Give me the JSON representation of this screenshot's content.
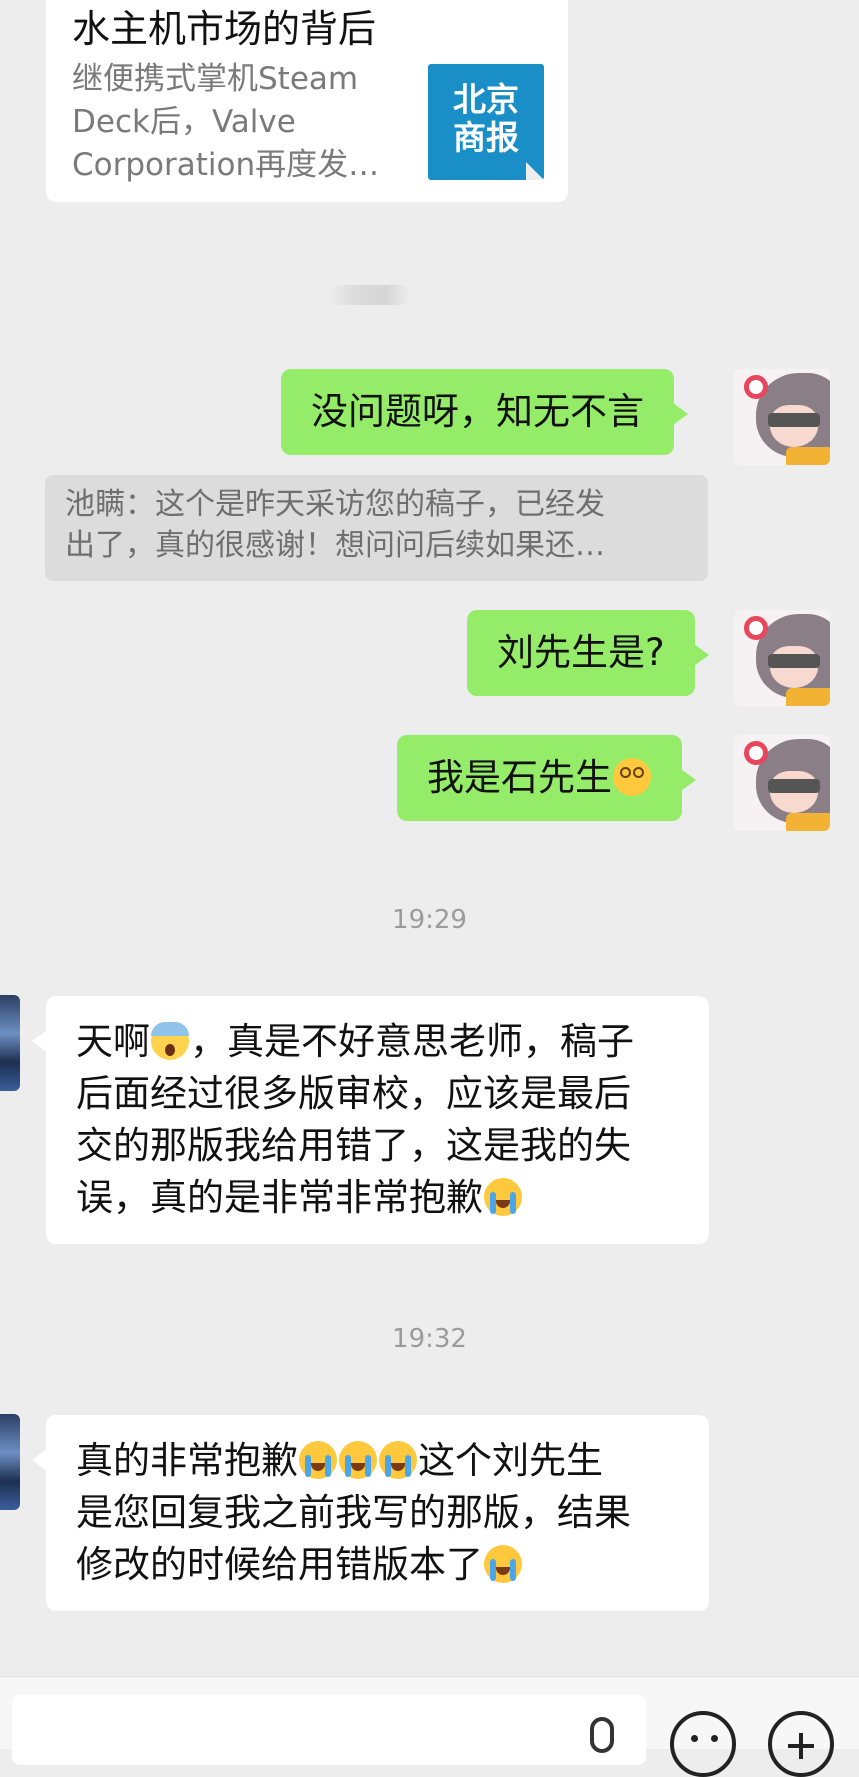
{
  "article_card": {
    "title": "水主机市场的背后",
    "description_lines": [
      "继便携式掌机Steam",
      "Deck后，Valve",
      "Corporation再度发…"
    ],
    "logo_line1": "北京",
    "logo_line2": "商报"
  },
  "messages": [
    {
      "id": "m1",
      "text": "没问题呀，知无不言"
    },
    {
      "id": "quote",
      "line1": "池瞒：这个是昨天采访您的稿子，已经发",
      "line2": "出了，真的很感谢！想问问后续如果还…"
    },
    {
      "id": "m2",
      "text": "刘先生是?"
    },
    {
      "id": "m3",
      "text": "我是石先生",
      "emoji": "dizzy-face"
    }
  ],
  "time1": "19:29",
  "reply1": {
    "line1_a": "天啊",
    "line1_b": "，真是不好意思老师，稿子",
    "line2": "后面经过很多版审校，应该是最后",
    "line3": "交的那版我给用错了，这是我的失",
    "line4": "误，真的是非常非常抱歉"
  },
  "time2": "19:32",
  "reply2": {
    "line1_a": "真的非常抱歉",
    "line1_b": "这个刘先生",
    "line2": "是您回复我之前我写的那版，结果",
    "line3": "修改的时候给用错版本了"
  },
  "colors": {
    "background": "#ededed",
    "sent_bubble": "#95ec69",
    "received_bubble": "#ffffff",
    "quote_bg": "#dcdcdc",
    "logo_blue": "#1a8ec6"
  },
  "icons": [
    "voice-icon",
    "emoji-icon",
    "plus-icon",
    "scream-emoji",
    "loudly-crying-emoji",
    "dizzy-face-emoji"
  ]
}
